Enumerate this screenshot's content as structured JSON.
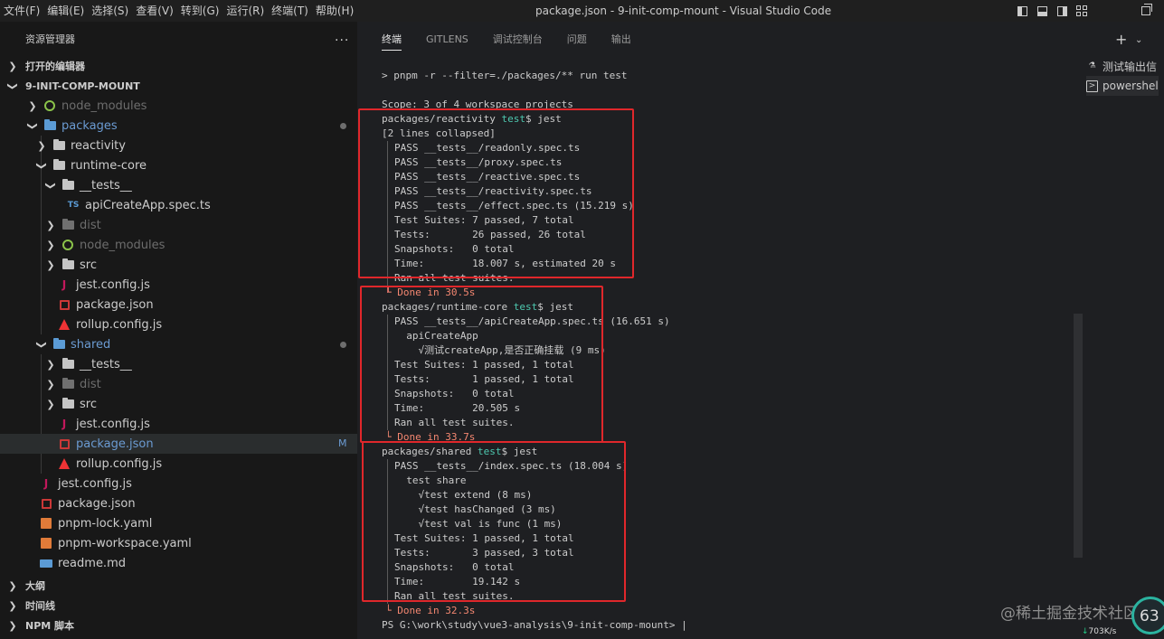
{
  "titlebar": {
    "menu": [
      "文件(F)",
      "编辑(E)",
      "选择(S)",
      "查看(V)",
      "转到(G)",
      "运行(R)",
      "终端(T)",
      "帮助(H)"
    ],
    "title": "package.json - 9-init-comp-mount - Visual Studio Code"
  },
  "sidebar": {
    "header": "资源管理器",
    "open_editors": "打开的编辑器",
    "project": "9-INIT-COMP-MOUNT",
    "outline": "大纲",
    "timeline": "时间线",
    "npm": "NPM 脚本",
    "items": [
      {
        "label": "node_modules"
      },
      {
        "label": "packages"
      },
      {
        "label": "reactivity"
      },
      {
        "label": "runtime-core"
      },
      {
        "label": "__tests__"
      },
      {
        "label": "apiCreateApp.spec.ts"
      },
      {
        "label": "dist"
      },
      {
        "label": "node_modules"
      },
      {
        "label": "src"
      },
      {
        "label": "jest.config.js"
      },
      {
        "label": "package.json"
      },
      {
        "label": "rollup.config.js"
      },
      {
        "label": "shared"
      },
      {
        "label": "__tests__"
      },
      {
        "label": "dist"
      },
      {
        "label": "src"
      },
      {
        "label": "jest.config.js"
      },
      {
        "label": "package.json"
      },
      {
        "label": "rollup.config.js"
      },
      {
        "label": "jest.config.js"
      },
      {
        "label": "package.json"
      },
      {
        "label": "pnpm-lock.yaml"
      },
      {
        "label": "pnpm-workspace.yaml"
      },
      {
        "label": "readme.md"
      }
    ],
    "modified_badge": "M"
  },
  "panel": {
    "tabs": [
      "终端",
      "GITLENS",
      "调试控制台",
      "问题",
      "输出"
    ],
    "terminals": [
      "测试输出信",
      "powershel"
    ]
  },
  "terminal": {
    "prompt_cmd": "> pnpm -r --filter=./packages/** run test",
    "scope": "Scope: 3 of 4 workspace projects",
    "r1": {
      "head_pkg": "packages/reactivity",
      "head_branch": "test",
      "head_cmd": "$ jest",
      "collapsed": "[2 lines collapsed]",
      "lines": [
        "PASS __tests__/readonly.spec.ts",
        "PASS __tests__/proxy.spec.ts",
        "PASS __tests__/reactive.spec.ts",
        "PASS __tests__/reactivity.spec.ts",
        "PASS __tests__/effect.spec.ts (15.219 s)",
        "Test Suites: 7 passed, 7 total",
        "Tests:       26 passed, 26 total",
        "Snapshots:   0 total",
        "Time:        18.007 s, estimated 20 s",
        "Ran all test suites."
      ],
      "done": "Done in 30.5s"
    },
    "r2": {
      "head_pkg": "packages/runtime-core",
      "head_branch": "test",
      "head_cmd": "$ jest",
      "lines": [
        "PASS __tests__/apiCreateApp.spec.ts (16.651 s)",
        "  apiCreateApp",
        "    √测试createApp,是否正确挂载 (9 ms)",
        "Test Suites: 1 passed, 1 total",
        "Tests:       1 passed, 1 total",
        "Snapshots:   0 total",
        "Time:        20.505 s",
        "Ran all test suites."
      ],
      "done": "Done in 33.7s"
    },
    "r3": {
      "head_pkg": "packages/shared",
      "head_branch": "test",
      "head_cmd": "$ jest",
      "lines": [
        "PASS __tests__/index.spec.ts (18.004 s)",
        "  test share",
        "    √test extend (8 ms)",
        "    √test hasChanged (3 ms)",
        "    √test val is func (1 ms)",
        "Test Suites: 1 passed, 1 total",
        "Tests:       3 passed, 3 total",
        "Snapshots:   0 total",
        "Time:        19.142 s",
        "Ran all test suites."
      ],
      "done": "Done in 32.3s"
    },
    "final_prompt": "PS G:\\work\\study\\vue3-analysis\\9-init-comp-mount>"
  },
  "overlay": {
    "watermark": "@稀土掘金技术社区",
    "net_num": "63",
    "net_speed": "703",
    "net_unit": "K/s"
  },
  "colors": {
    "highlight_box": "#e0272b",
    "accent_branch": "#4ec9b0"
  }
}
